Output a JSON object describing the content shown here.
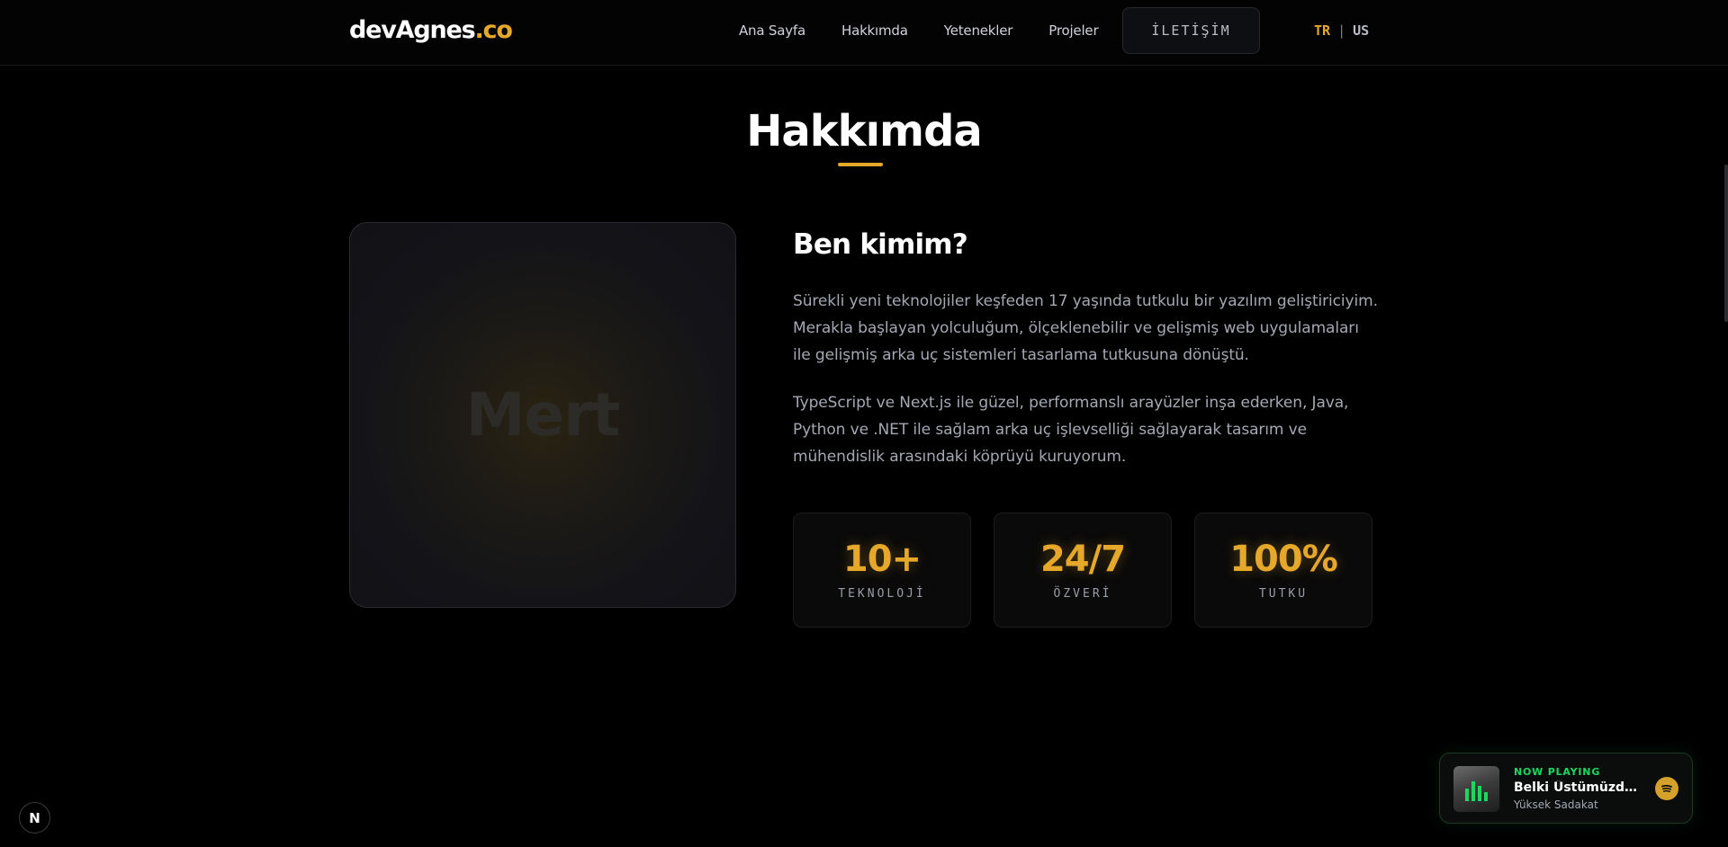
{
  "nav": {
    "logo_main": "devAgnes",
    "logo_tld": ".co",
    "links": [
      "Ana Sayfa",
      "Hakkımda",
      "Yetenekler",
      "Projeler"
    ],
    "contact_label": "İLETİŞİM",
    "lang_tr": "TR",
    "lang_sep": "|",
    "lang_us": "US"
  },
  "about": {
    "title": "Hakkımda",
    "photo_placeholder": "Mert",
    "who_title": "Ben kimim?",
    "para1": "Sürekli yeni teknolojiler keşfeden 17 yaşında tutkulu bir yazılım geliştiriciyim. Merakla başlayan yolculuğum, ölçeklenebilir ve gelişmiş web uygulamaları ile gelişmiş arka uç sistemleri tasarlama tutkusuna dönüştü.",
    "para2": "TypeScript ve Next.js ile güzel, performanslı arayüzler inşa ederken, Java, Python ve .NET ile sağlam arka uç işlevselliği sağlayarak tasarım ve mühendislik arasındaki köprüyü kuruyorum.",
    "stats": [
      {
        "value": "10+",
        "label": "TEKNOLOJİ"
      },
      {
        "value": "24/7",
        "label": "ÖZVERİ"
      },
      {
        "value": "100%",
        "label": "TUTKU"
      }
    ]
  },
  "next_badge": "N",
  "player": {
    "label": "NOW PLAYING",
    "title": "Belki Üstümüzden Bir Kuş Geçer",
    "artist": "Yüksek Sadakat",
    "icon": "spotify-icon"
  },
  "colors": {
    "accent": "#e6a82b",
    "spotify_green": "#1ed760",
    "background": "#000000"
  }
}
